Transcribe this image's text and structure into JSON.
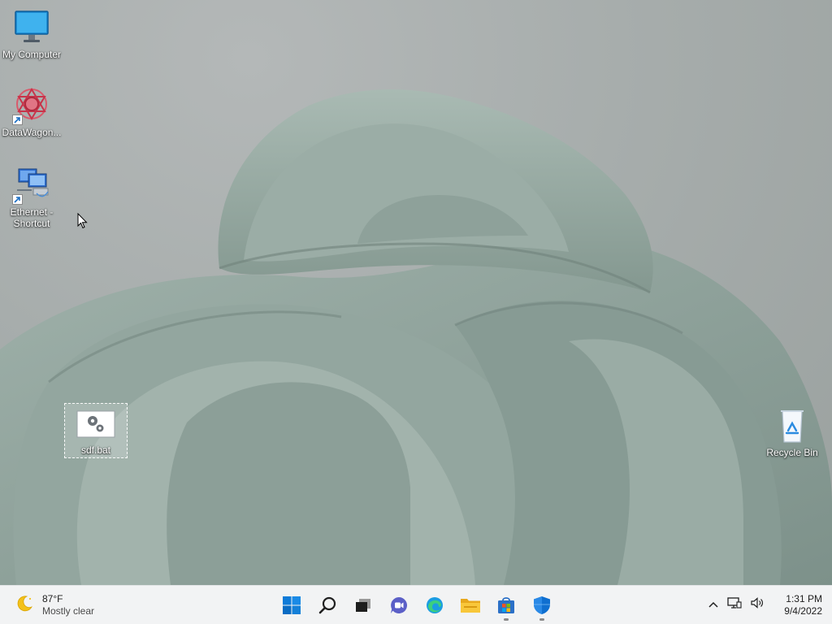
{
  "desktop": {
    "icons": [
      {
        "label": "My Computer"
      },
      {
        "label": "DataWagon..."
      },
      {
        "label_line1": "Ethernet -",
        "label_line2": "Shortcut"
      },
      {
        "label": "sdf.bat"
      },
      {
        "label": "Recycle Bin"
      }
    ]
  },
  "taskbar": {
    "weather": {
      "temp": "87°F",
      "condition": "Mostly clear"
    },
    "apps": [
      {
        "icon": "windows-start-icon"
      },
      {
        "icon": "search-icon"
      },
      {
        "icon": "task-view-icon"
      },
      {
        "icon": "teams-chat-icon"
      },
      {
        "icon": "edge-browser-icon"
      },
      {
        "icon": "file-explorer-icon"
      },
      {
        "icon": "microsoft-store-icon"
      },
      {
        "icon": "windows-security-icon"
      }
    ],
    "tray": {
      "time": "1:31 PM",
      "date": "9/4/2022"
    }
  },
  "colors": {
    "taskbar_bg": "#f2f3f4",
    "windows_blue": "#0078d4",
    "wallpaper_petal": "#8fa29b"
  }
}
